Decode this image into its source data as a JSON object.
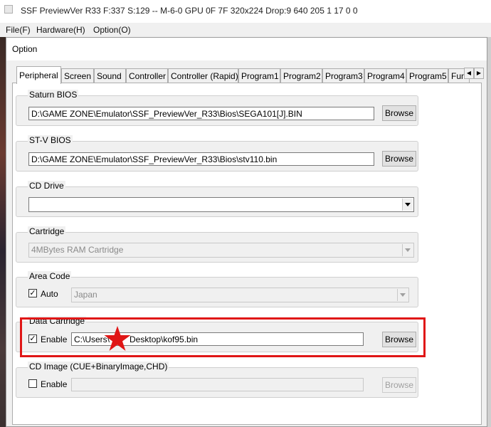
{
  "window": {
    "title": "SSF PreviewVer R33  F:337 S:129 -- M-6-0 GPU 0F 7F 320x224 Drop:9 640 205 1 17 0 0",
    "menu": [
      "File(F)",
      "Hardware(H)",
      "Option(O)"
    ]
  },
  "dialog": {
    "title": "Option",
    "tabs": [
      "Peripheral",
      "Screen",
      "Sound",
      "Controller",
      "Controller (Rapid)",
      "Program1",
      "Program2",
      "Program3",
      "Program4",
      "Program5",
      "Fun"
    ],
    "active_tab": "Peripheral"
  },
  "saturn_bios": {
    "label": "Saturn BIOS",
    "path": "D:\\GAME ZONE\\Emulator\\SSF_PreviewVer_R33\\Bios\\SEGA101[J].BIN",
    "button": "Browse"
  },
  "stv_bios": {
    "label": "ST-V BIOS",
    "path": "D:\\GAME ZONE\\Emulator\\SSF_PreviewVer_R33\\Bios\\stv110.bin",
    "button": "Browse"
  },
  "cd_drive": {
    "label": "CD Drive",
    "value": ""
  },
  "cartridge": {
    "label": "Cartridge",
    "value": "4MBytes RAM Cartridge"
  },
  "area_code": {
    "label": "Area Code",
    "auto_label": "Auto",
    "auto_checked": true,
    "value": "Japan"
  },
  "data_cartridge": {
    "label": "Data Cartridge",
    "enable_label": "Enable",
    "enabled": true,
    "path_prefix": "C:\\Users\\",
    "path_suffix": "Desktop\\kof95.bin",
    "button": "Browse"
  },
  "cd_image": {
    "label": "CD Image (CUE+BinaryImage,CHD)",
    "enable_label": "Enable",
    "enabled": false,
    "path": "",
    "button": "Browse"
  },
  "colors": {
    "highlight": "#e01616",
    "star": "#e01616"
  }
}
